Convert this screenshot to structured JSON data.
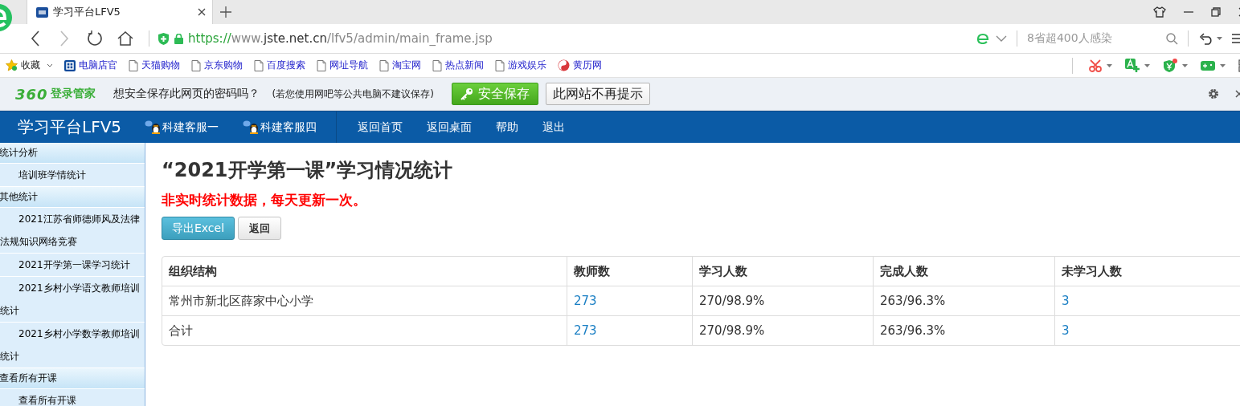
{
  "browser_tab": {
    "title": "学习平台LFV5"
  },
  "address": {
    "url_parts": [
      {
        "text": "https://",
        "kind": "scheme"
      },
      {
        "text": "www.",
        "kind": "sub"
      },
      {
        "text": "jste.net.cn",
        "kind": "host"
      },
      {
        "text": "/lfv5/admin/main_frame.jsp",
        "kind": "path"
      }
    ]
  },
  "search": {
    "placeholder": "8省超400人感染"
  },
  "bookmarks": [
    {
      "label": "收藏",
      "kind": "favorites"
    },
    {
      "label": "电脑店官",
      "kind": "brand"
    },
    {
      "label": "天猫购物",
      "kind": "page"
    },
    {
      "label": "京东购物",
      "kind": "page"
    },
    {
      "label": "百度搜索",
      "kind": "page"
    },
    {
      "label": "网址导航",
      "kind": "page"
    },
    {
      "label": "淘宝网",
      "kind": "page"
    },
    {
      "label": "热点新闻",
      "kind": "page"
    },
    {
      "label": "游戏娱乐",
      "kind": "page"
    },
    {
      "label": "黄历网",
      "kind": "almanac"
    }
  ],
  "password_bar": {
    "brand": "360",
    "brand_label": "登录管家",
    "question": "想安全保存此网页的密码吗？",
    "note": "(若您使用网吧等公共电脑不建议保存)",
    "save_button": "安全保存",
    "never_button": "此网站不再提示"
  },
  "nav": {
    "title": "学习平台LFV5",
    "links": [
      {
        "label": "科建客服一",
        "kind": "qq"
      },
      {
        "label": "科建客服四",
        "kind": "qq"
      },
      {
        "label": "返回首页",
        "kind": "plain"
      },
      {
        "label": "返回桌面",
        "kind": "plain"
      },
      {
        "label": "帮助",
        "kind": "plain"
      },
      {
        "label": "退出",
        "kind": "plain"
      }
    ]
  },
  "sidebar": {
    "groups": [
      {
        "label": "统计分析",
        "children": [
          {
            "label": "培训班学情统计"
          }
        ]
      },
      {
        "label": "其他统计",
        "children": [
          {
            "label": "2021江苏省师德师风及法律法规知识网络竞赛"
          },
          {
            "label": "2021开学第一课学习统计"
          },
          {
            "label": "2021乡村小学语文教师培训统计"
          },
          {
            "label": "2021乡村小学数学教师培训统计"
          }
        ]
      },
      {
        "label": "查看所有开课",
        "children": [
          {
            "label": "查看所有开课"
          }
        ]
      }
    ]
  },
  "main": {
    "title": "“2021开学第一课”学习情况统计",
    "notice": "非实时统计数据，每天更新一次。",
    "buttons": [
      {
        "label": "导出Excel",
        "kind": "primary"
      },
      {
        "label": "返回",
        "kind": "default"
      }
    ],
    "table": {
      "columns": [
        "组织结构",
        "教师数",
        "学习人数",
        "完成人数",
        "未学习人数"
      ],
      "rows": [
        [
          {
            "text": "常州市新北区薛家中心小学",
            "kind": "text"
          },
          {
            "text": "273",
            "kind": "link"
          },
          {
            "text": "270/98.9%",
            "kind": "text"
          },
          {
            "text": "263/96.3%",
            "kind": "text"
          },
          {
            "text": "3",
            "kind": "link"
          }
        ],
        [
          {
            "text": "合计",
            "kind": "text"
          },
          {
            "text": "273",
            "kind": "link"
          },
          {
            "text": "270/98.9%",
            "kind": "text"
          },
          {
            "text": "263/96.3%",
            "kind": "text"
          },
          {
            "text": "3",
            "kind": "link"
          }
        ]
      ]
    }
  }
}
